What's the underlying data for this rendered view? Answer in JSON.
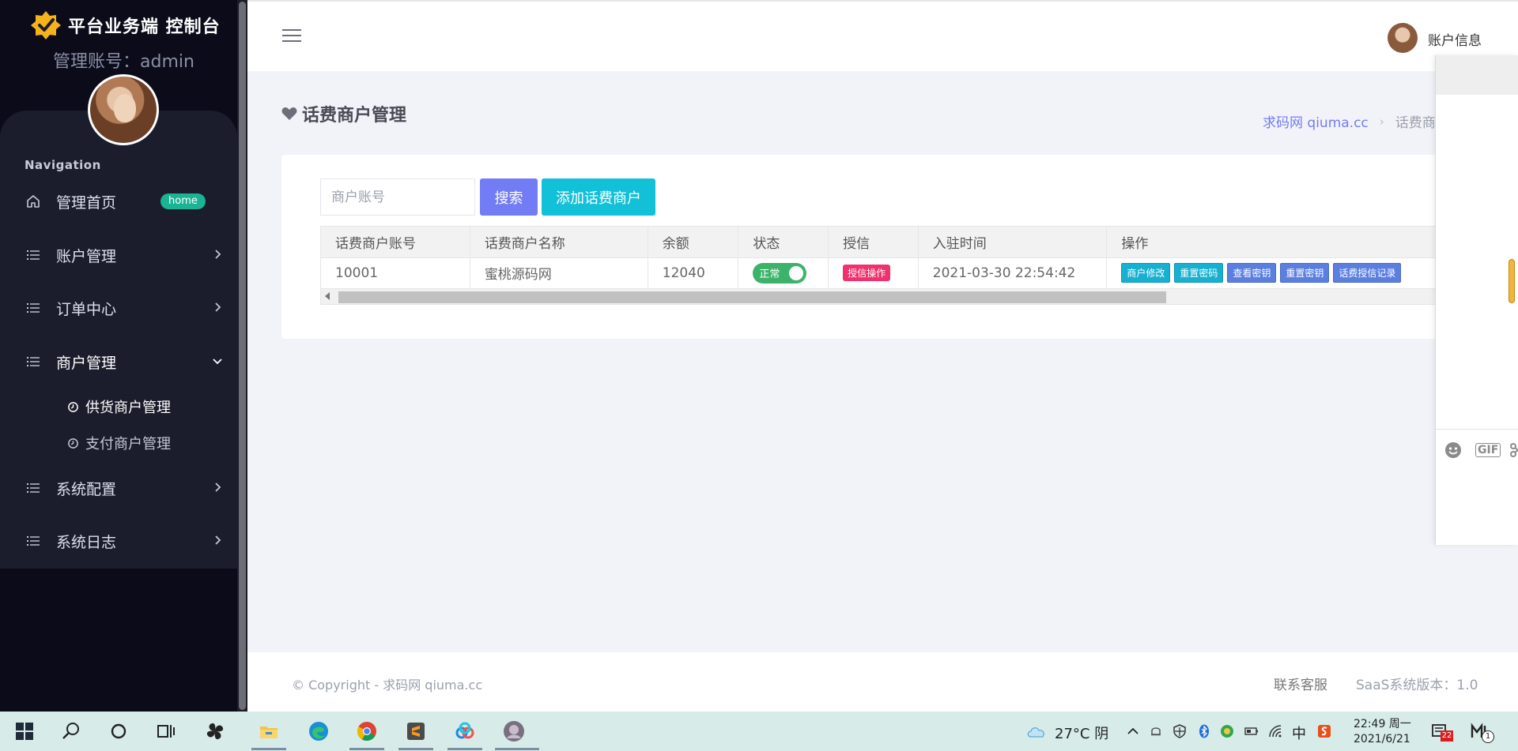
{
  "sidebar": {
    "brand_title": "平台业务端 控制台",
    "admin_account": "管理账号：admin",
    "nav_heading": "Navigation",
    "items": [
      {
        "label": "管理首页",
        "badge": "home"
      },
      {
        "label": "账户管理"
      },
      {
        "label": "订单中心"
      },
      {
        "label": "商户管理",
        "expanded": true
      },
      {
        "label": "系统配置"
      },
      {
        "label": "系统日志"
      }
    ],
    "sub_items": [
      {
        "label": "供货商户管理",
        "active": true
      },
      {
        "label": "支付商户管理",
        "active": false
      }
    ]
  },
  "topbar": {
    "account_info": "账户信息"
  },
  "page": {
    "title": "话费商户管理",
    "breadcrumb_home": "求码网 qiuma.cc",
    "breadcrumb_current": "话费商"
  },
  "search": {
    "placeholder": "商户账号",
    "search_label": "搜索",
    "add_label": "添加话费商户"
  },
  "table": {
    "columns": [
      "话费商户账号",
      "话费商户名称",
      "余额",
      "状态",
      "授信",
      "入驻时间",
      "操作"
    ],
    "rows": [
      {
        "account": "10001",
        "name": "蜜桃源码网",
        "balance": "12040",
        "status": "正常",
        "credit_action": "授信操作",
        "join_time": "2021-03-30 22:54:42",
        "operations": [
          "商户修改",
          "重置密码",
          "查看密钥",
          "重置密钥",
          "话费授信记录"
        ]
      }
    ]
  },
  "footer": {
    "copyright": "© Copyright - 求码网 qiuma.cc",
    "contact": "联系客服",
    "version": "SaaS系统版本：1.0"
  },
  "chat": {
    "gif": "GIF"
  },
  "taskbar": {
    "weather": "27°C  阴",
    "ime": "中",
    "time": "22:49 周一",
    "date": "2021/6/21",
    "notification_count": "22",
    "mail_count": "1"
  },
  "colors": {
    "primary": "#727cf5",
    "cyan": "#12c0d8",
    "success": "#1ab394",
    "danger": "#f1316d",
    "sidebar_bg": "#0b0b1a"
  }
}
